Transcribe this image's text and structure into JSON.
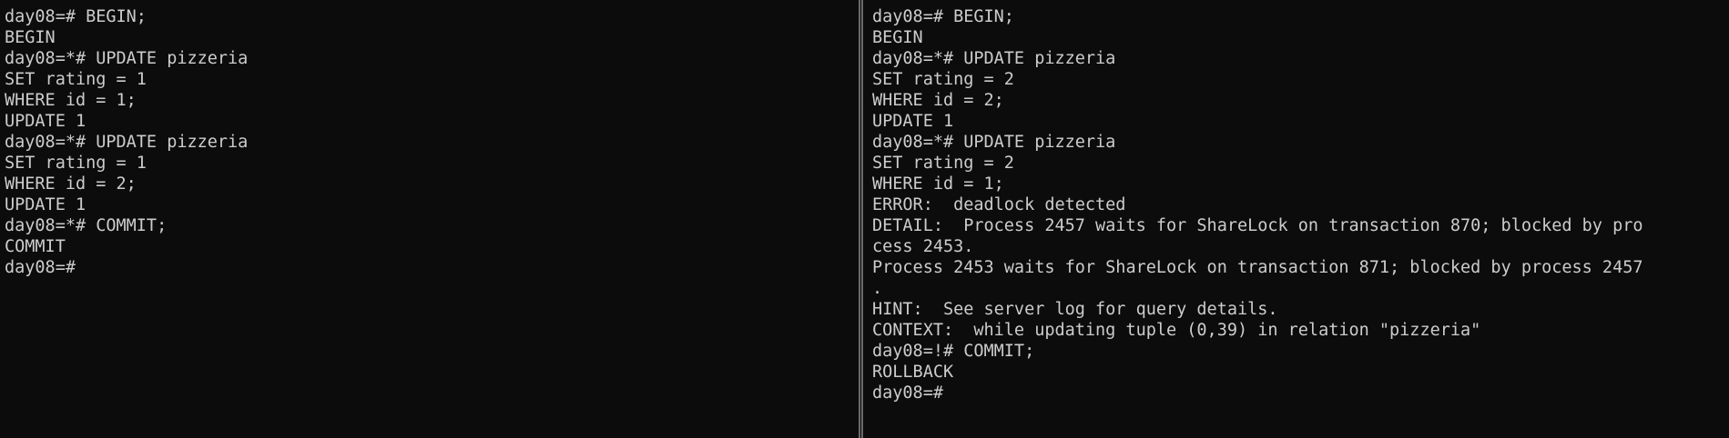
{
  "left_pane": {
    "lines": [
      "day08=# BEGIN;",
      "BEGIN",
      "day08=*# UPDATE pizzeria",
      "SET rating = 1",
      "WHERE id = 1;",
      "UPDATE 1",
      "day08=*# UPDATE pizzeria",
      "SET rating = 1",
      "WHERE id = 2;",
      "UPDATE 1",
      "day08=*# COMMIT;",
      "COMMIT",
      "day08=#"
    ]
  },
  "right_pane": {
    "lines": [
      "day08=# BEGIN;",
      "BEGIN",
      "day08=*# UPDATE pizzeria",
      "SET rating = 2",
      "WHERE id = 2;",
      "UPDATE 1",
      "day08=*# UPDATE pizzeria",
      "SET rating = 2",
      "WHERE id = 1;",
      "ERROR:  deadlock detected",
      "DETAIL:  Process 2457 waits for ShareLock on transaction 870; blocked by pro",
      "cess 2453.",
      "Process 2453 waits for ShareLock on transaction 871; blocked by process 2457",
      ".",
      "HINT:  See server log for query details.",
      "CONTEXT:  while updating tuple (0,39) in relation \"pizzeria\"",
      "day08=!# COMMIT;",
      "ROLLBACK",
      "day08=#"
    ]
  },
  "colors": {
    "background": "#0c0c0c",
    "foreground": "#cccccc",
    "divider": "#6a6a6a"
  }
}
